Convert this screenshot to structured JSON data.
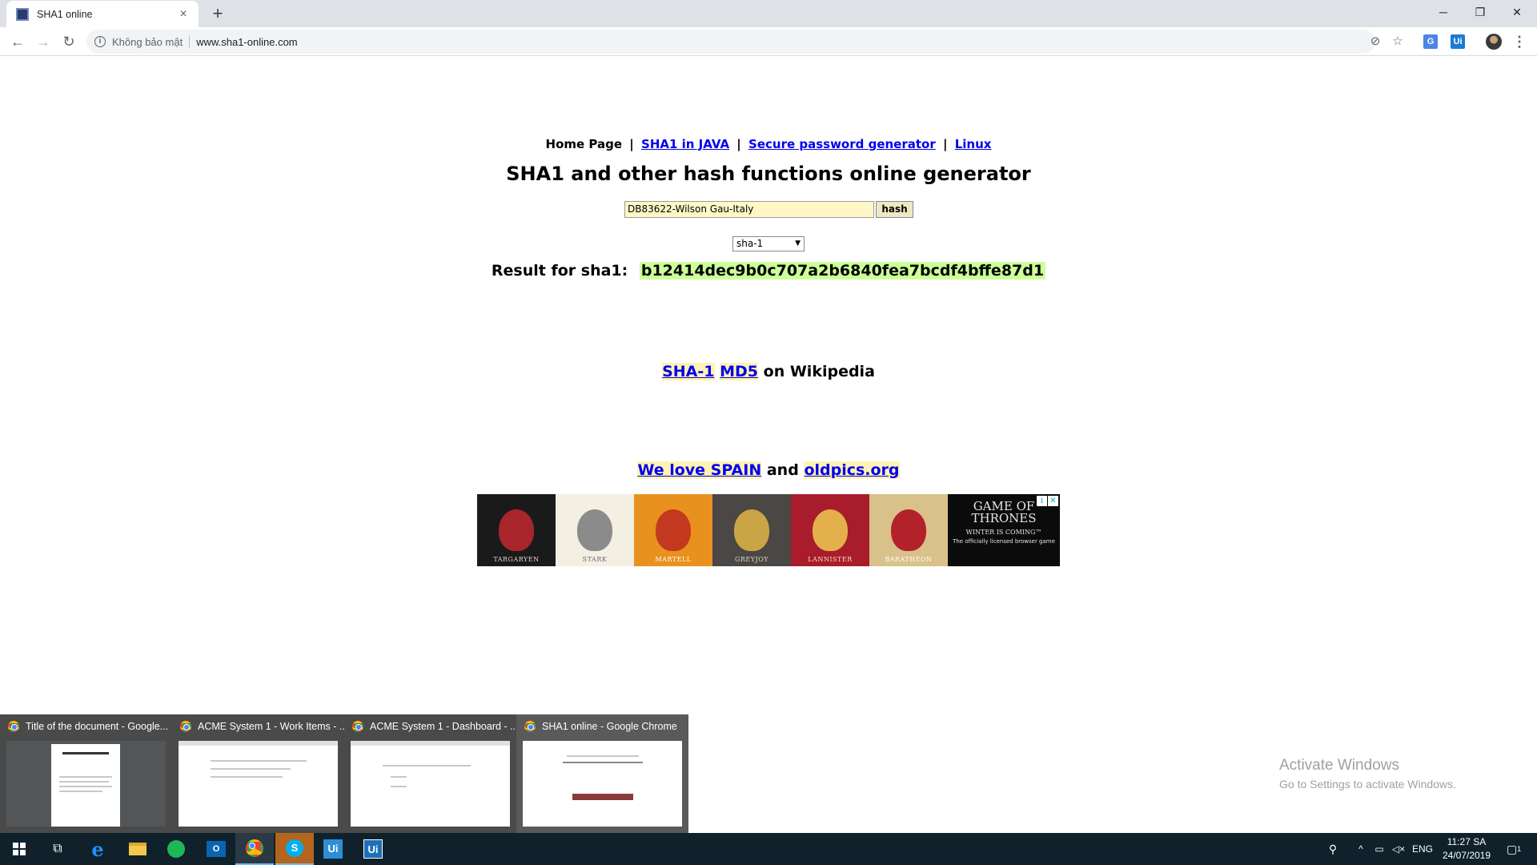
{
  "browser": {
    "tab_title": "SHA1 online",
    "tab_close": "×",
    "new_tab": "+",
    "security_label": "Không bảo mật",
    "url": "www.sha1-online.com",
    "window_controls": {
      "minimize": "─",
      "restore": "❐",
      "close": "✕"
    },
    "extensions": [
      "Ui"
    ]
  },
  "page": {
    "nav": {
      "home": "Home Page",
      "sep": "|",
      "links": [
        "SHA1 in JAVA",
        "Secure password generator",
        "Linux"
      ]
    },
    "headline": "SHA1 and other hash functions online generator",
    "form": {
      "input_value": "DB83622-Wilson Gau-Italy",
      "hash_button": "hash",
      "algorithm": "sha-1"
    },
    "result": {
      "label": "Result for sha1:",
      "value": "b12414dec9b0c707a2b6840fea7bcdf4bffe87d1"
    },
    "wiki": {
      "link1": "SHA-1",
      "link2": "MD5",
      "suffix": "on Wikipedia"
    },
    "promo": {
      "link1": "We love SPAIN",
      "joiner": "and",
      "link2": "oldpics.org"
    },
    "banner": {
      "houses": [
        {
          "name": "TARGARYEN",
          "bg": "#1a1a1a",
          "sigil": "#a8262b",
          "text": "#e0d6c8"
        },
        {
          "name": "STARK",
          "bg": "#f4efe3",
          "sigil": "#8b8b8b",
          "text": "#6a6a6a"
        },
        {
          "name": "MARTELL",
          "bg": "#e8911f",
          "sigil": "#c2391f",
          "text": "#ffffff"
        },
        {
          "name": "GREYJOY",
          "bg": "#4a4744",
          "sigil": "#c9a545",
          "text": "#e0d6c8"
        },
        {
          "name": "LANNISTER",
          "bg": "#a81c2c",
          "sigil": "#e3b04b",
          "text": "#f2e1c1"
        },
        {
          "name": "BARATHEON",
          "bg": "#d9c18a",
          "sigil": "#b3222b",
          "text": "#ffffff"
        }
      ],
      "ad": {
        "title": "GAME OF THRONES",
        "tagline": "WINTER IS COMING™",
        "subtitle": "The officially licensed browser game",
        "badge_info": "i",
        "badge_close": "✕"
      }
    }
  },
  "thumbnails": [
    {
      "title": "Title of the document - Google..."
    },
    {
      "title": "ACME System 1 - Work Items - ..."
    },
    {
      "title": "ACME System 1 - Dashboard - ..."
    },
    {
      "title": "SHA1 online - Google Chrome"
    }
  ],
  "watermark": {
    "line1": "Activate Windows",
    "line2": "Go to Settings to activate Windows."
  },
  "taskbar": {
    "apps": [
      "windows-start",
      "task-view",
      "edge",
      "file-explorer",
      "spotify",
      "outlook",
      "chrome",
      "skype",
      "uipath-studio",
      "uipath-robot"
    ],
    "tray_language": "ENG",
    "time": "11:27 SA",
    "date": "24/07/2019",
    "notifications": "1"
  },
  "colors": {
    "hash_highlight": "#ccff99",
    "input_bg": "#fff8c6",
    "link": "#0000ee",
    "taskbar": "#10212b"
  }
}
